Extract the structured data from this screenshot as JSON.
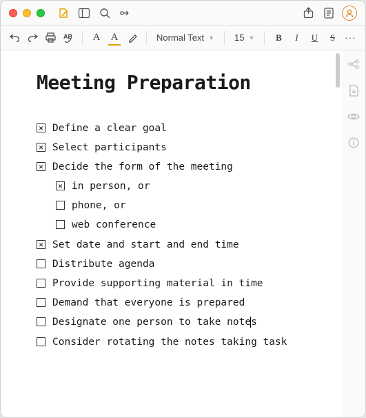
{
  "window": {
    "toolbar": {
      "style_name": "Normal Text",
      "font_size": "15"
    }
  },
  "doc": {
    "title": "Meeting Preparation",
    "tasks": [
      {
        "text": "Define a clear goal",
        "done": true,
        "indent": 0
      },
      {
        "text": "Select participants",
        "done": true,
        "indent": 0
      },
      {
        "text": "Decide the form of the meeting",
        "done": true,
        "indent": 0
      },
      {
        "text": "in person, or",
        "done": true,
        "indent": 1
      },
      {
        "text": "phone, or",
        "done": false,
        "indent": 1
      },
      {
        "text": "web conference",
        "done": false,
        "indent": 1
      },
      {
        "text": "Set date and start and end time",
        "done": true,
        "indent": 0
      },
      {
        "text": "Distribute agenda",
        "done": false,
        "indent": 0
      },
      {
        "text": "Provide supporting material in time",
        "done": false,
        "indent": 0
      },
      {
        "text": "Demand that everyone is prepared",
        "done": false,
        "indent": 0
      },
      {
        "text": "Designate one person to take notes",
        "done": false,
        "indent": 0,
        "caret_at": 33
      },
      {
        "text": "Consider rotating the notes taking task",
        "done": false,
        "indent": 0
      }
    ]
  }
}
